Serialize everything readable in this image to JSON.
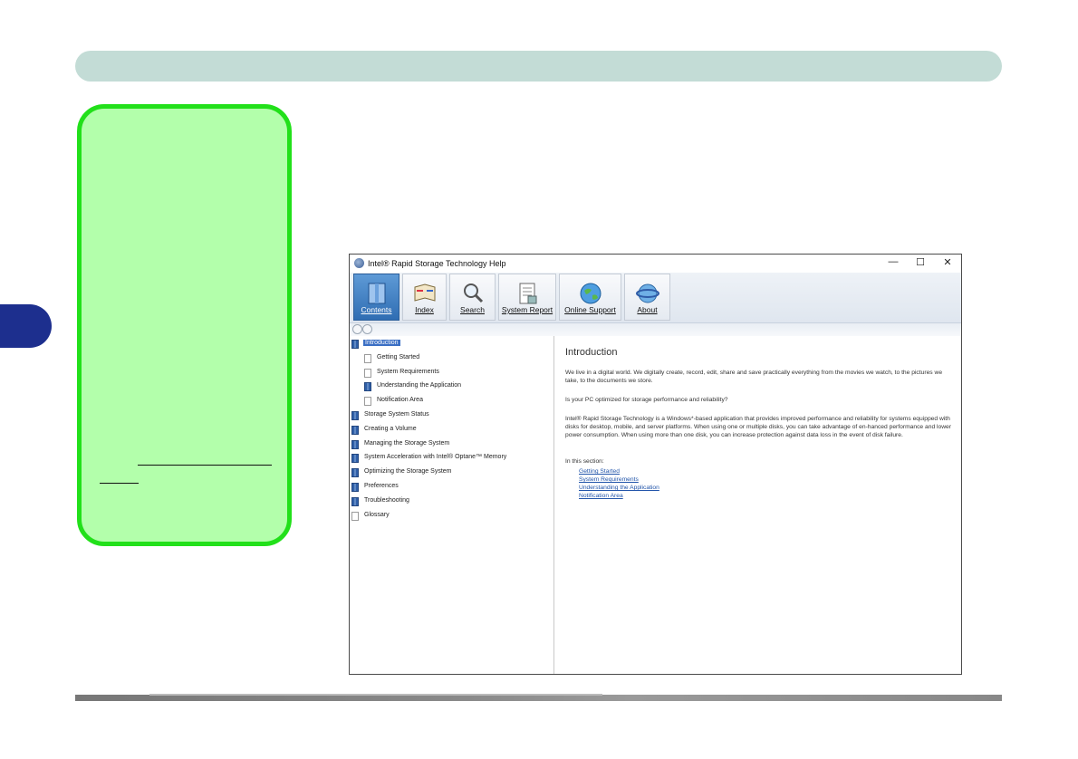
{
  "window": {
    "title": "Intel® Rapid Storage Technology Help",
    "controls": [
      "—",
      "☐",
      "✕"
    ]
  },
  "toolbar": {
    "buttons": [
      {
        "label": "Contents",
        "icon": "contents-book-icon"
      },
      {
        "label": "Index",
        "icon": "index-book-icon"
      },
      {
        "label": "Search",
        "icon": "magnifier-icon"
      },
      {
        "label": "System Report",
        "icon": "report-icon"
      },
      {
        "label": "Online Support",
        "icon": "globe-icon"
      },
      {
        "label": "About",
        "icon": "about-globe-icon"
      }
    ]
  },
  "toc": {
    "items": [
      {
        "label": "Introduction",
        "icon": "book"
      },
      {
        "label": "Getting Started",
        "icon": "page"
      },
      {
        "label": "System Requirements",
        "icon": "page"
      },
      {
        "label": "Understanding the Application",
        "icon": "book"
      },
      {
        "label": "Notification Area",
        "icon": "page"
      },
      {
        "label": "Storage System Status",
        "icon": "book"
      },
      {
        "label": "Creating a Volume",
        "icon": "book"
      },
      {
        "label": "Managing the Storage System",
        "icon": "book"
      },
      {
        "label": "System Acceleration with Intel® Optane™ Memory",
        "icon": "book"
      },
      {
        "label": "Optimizing the Storage System",
        "icon": "book"
      },
      {
        "label": "Preferences",
        "icon": "book"
      },
      {
        "label": "Troubleshooting",
        "icon": "book"
      },
      {
        "label": "Glossary",
        "icon": "page"
      }
    ]
  },
  "content": {
    "heading": "Introduction",
    "p1": "We live in a digital world. We digitally create, record, edit, share and save practically everything from the movies we watch, to the pictures we take, to the documents we store.",
    "p2": "Is your PC optimized for storage performance and reliability?",
    "p3": "Intel® Rapid Storage Technology is a Windows*-based application that provides improved performance and reliability for systems equipped with disks for desktop, mobile, and server platforms. When using one or multiple disks, you can take advantage of en-hanced performance and lower power consumption. When using more than one disk, you can increase protection against data loss in the event of disk failure.",
    "p4": "In this section:",
    "links": [
      "Getting Started",
      "System Requirements",
      "Understanding the Application",
      "Notification Area"
    ]
  },
  "colors": {
    "header_bar": "#c3dcd6",
    "side_tab": "#1d2f8e",
    "note_fill": "#b3ffab",
    "note_border": "#22e01a"
  }
}
